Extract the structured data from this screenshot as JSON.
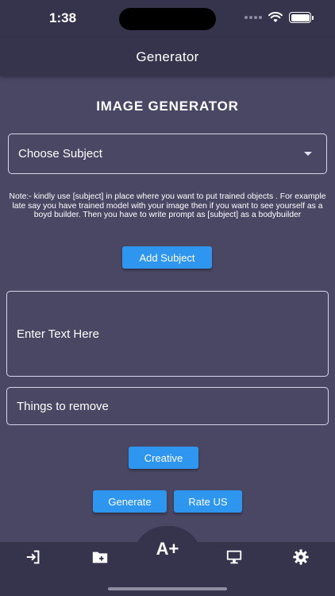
{
  "status": {
    "time": "1:38"
  },
  "app_bar": {
    "title": "Generator"
  },
  "main": {
    "heading": "IMAGE GENERATOR",
    "subject_select": {
      "value": "Choose Subject"
    },
    "note": "Note:- kindly use [subject] in place where you want to put trained objects . For example late say you have trained model with your image then if you want to see yourself as a boyd builder. Then you have to write prompt as [subject] as a bodybuilder",
    "add_subject_label": "Add Subject",
    "prompt_placeholder": "Enter Text Here",
    "remove_placeholder": "Things to remove",
    "creative_label": "Creative",
    "generate_label": "Generate",
    "rate_label": "Rate US"
  },
  "bottom_nav": {
    "center_label": "A+",
    "items": [
      {
        "icon": "login-icon"
      },
      {
        "icon": "folder-add-icon"
      },
      {
        "icon": "text-size-icon"
      },
      {
        "icon": "monitor-icon"
      },
      {
        "icon": "gear-icon"
      }
    ]
  },
  "colors": {
    "background": "#4a4765",
    "bar": "#36344d",
    "accent": "#2e96ef",
    "border": "#d8d6e6"
  }
}
